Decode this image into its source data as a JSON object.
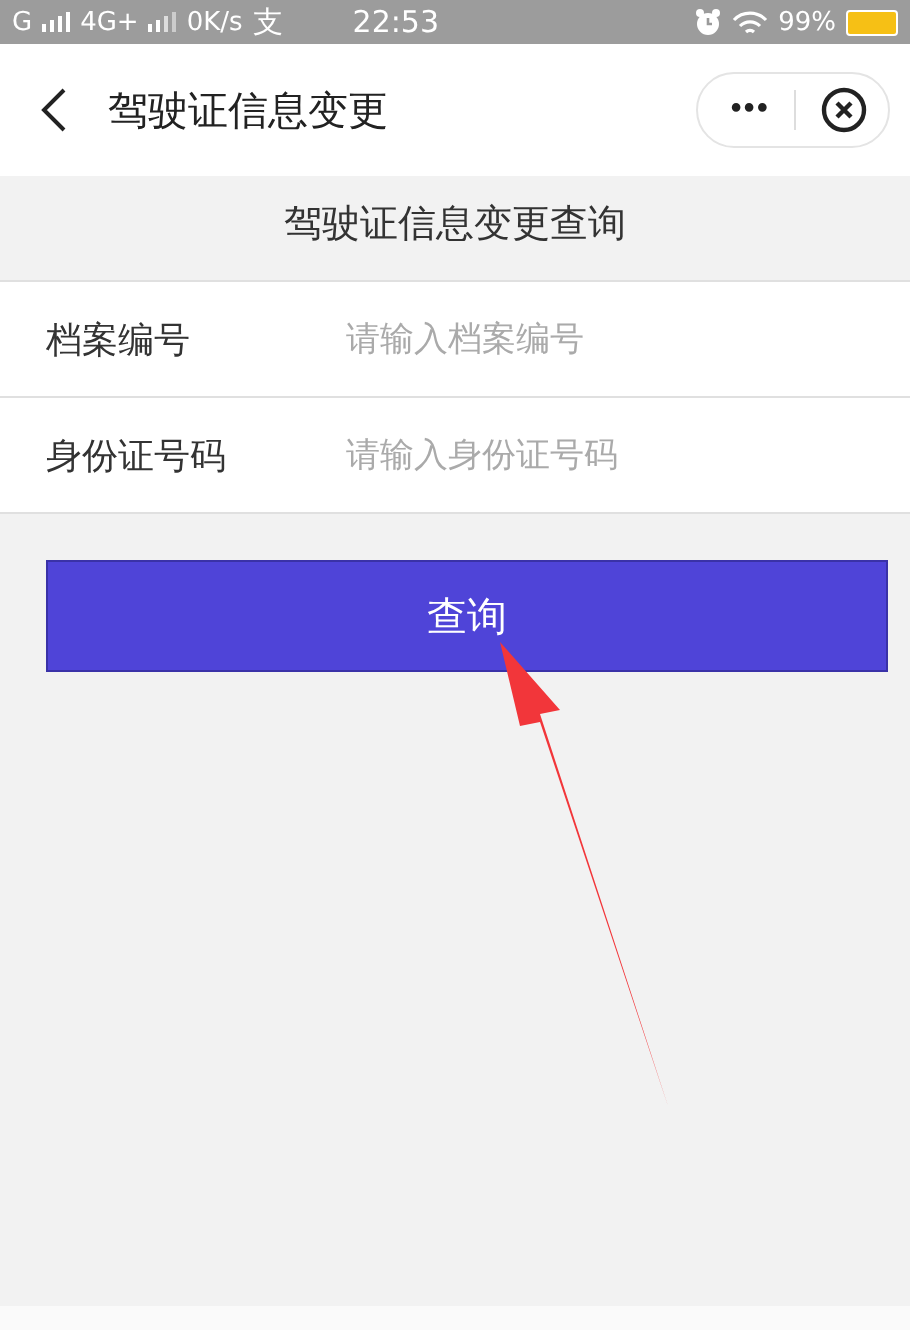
{
  "status_bar": {
    "carrier_1": "G",
    "network_2": "4G+",
    "speed": "0K/s",
    "app_glyph": "支",
    "time": "22:53",
    "battery": "99%"
  },
  "nav_bar": {
    "title": "驾驶证信息变更",
    "more": "•••"
  },
  "form": {
    "heading": "驾驶证信息变更查询",
    "fields": [
      {
        "label": "档案编号",
        "placeholder": "请输入档案编号"
      },
      {
        "label": "身份证号码",
        "placeholder": "请输入身份证号码"
      }
    ],
    "submit": "查询"
  }
}
